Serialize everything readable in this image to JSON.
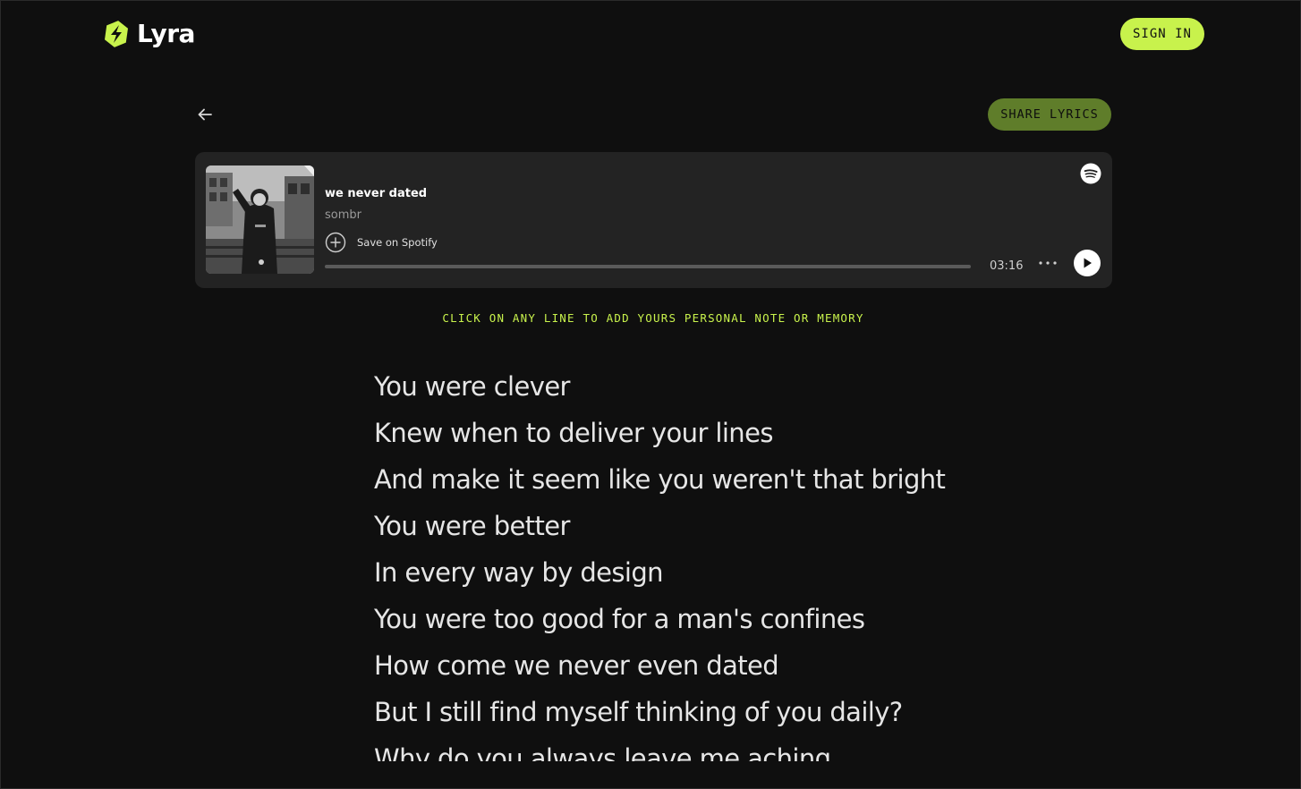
{
  "app": {
    "name": "Lyra",
    "accent_color": "#c8f24c",
    "share_button_color": "#5f7d2a",
    "background_color": "#0f0f0f"
  },
  "header": {
    "logo_text": "Lyra",
    "sign_in_label": "SIGN IN"
  },
  "toolbar": {
    "back_icon": "arrow-left-icon",
    "share_label": "SHARE LYRICS"
  },
  "player": {
    "title": "we never dated",
    "artist": "sombr",
    "save_label": "Save on Spotify",
    "duration": "03:16",
    "progress_fraction": 0,
    "icons": [
      "spotify-icon",
      "plus-circle-icon",
      "more-icon",
      "play-icon"
    ]
  },
  "hint": "CLICK ON ANY LINE TO ADD YOURS PERSONAL NOTE OR MEMORY",
  "lyrics": [
    "You were clever",
    "Knew when to deliver your lines",
    "And make it seem like you weren't that bright",
    "You were better",
    "In every way by design",
    "You were too good for a man's confines",
    "How come we never even dated",
    "But I still find myself thinking of you daily?",
    "Why do you always leave me aching"
  ]
}
